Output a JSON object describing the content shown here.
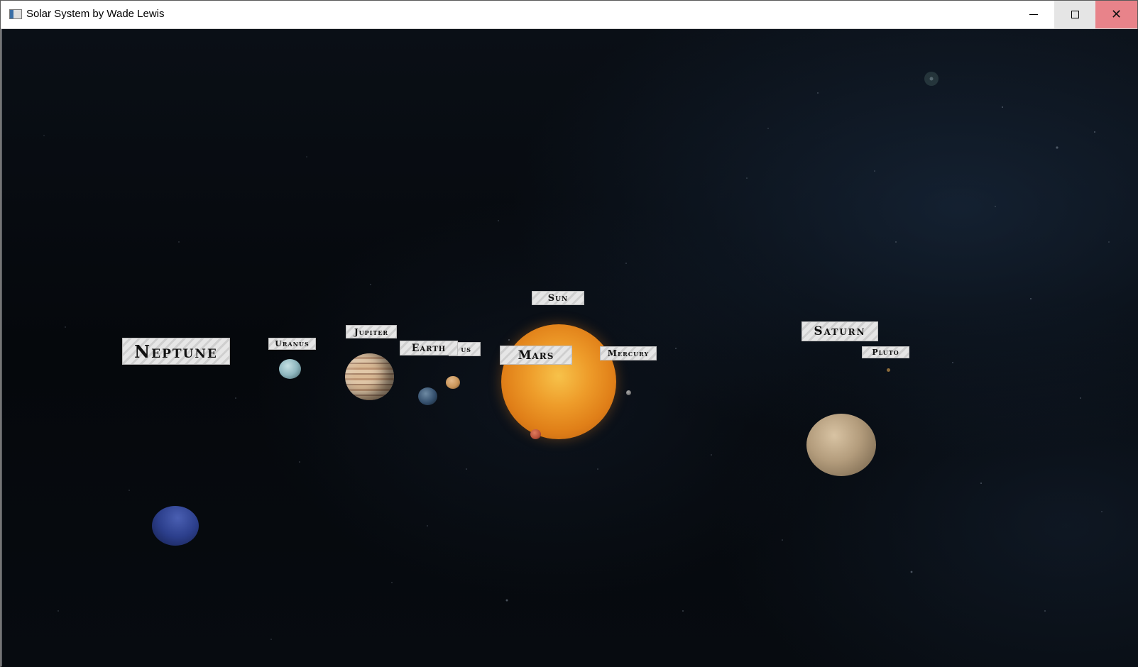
{
  "window": {
    "title": "Solar System by Wade Lewis",
    "controls": {
      "minimize": "minimize",
      "maximize": "maximize",
      "close": "close"
    }
  },
  "scene": {
    "background": "#05080c",
    "labels": {
      "sun": "Sun",
      "mercury": "Mercury",
      "venus_partial": "us",
      "earth": "Earth",
      "mars": "Mars",
      "jupiter": "Jupiter",
      "saturn": "Saturn",
      "uranus": "Uranus",
      "neptune": "Neptune",
      "pluto": "Pluto"
    },
    "colors": {
      "sun": "#e8891c",
      "mercury": "#7a7a7a",
      "venus": "#c9955a",
      "earth": "#35506e",
      "mars": "#b7513a",
      "jupiter": "#c9a585",
      "saturn": "#b8a282",
      "uranus": "#8fb7bf",
      "neptune": "#2c3f8c",
      "pluto": "#8a6a3a"
    }
  }
}
